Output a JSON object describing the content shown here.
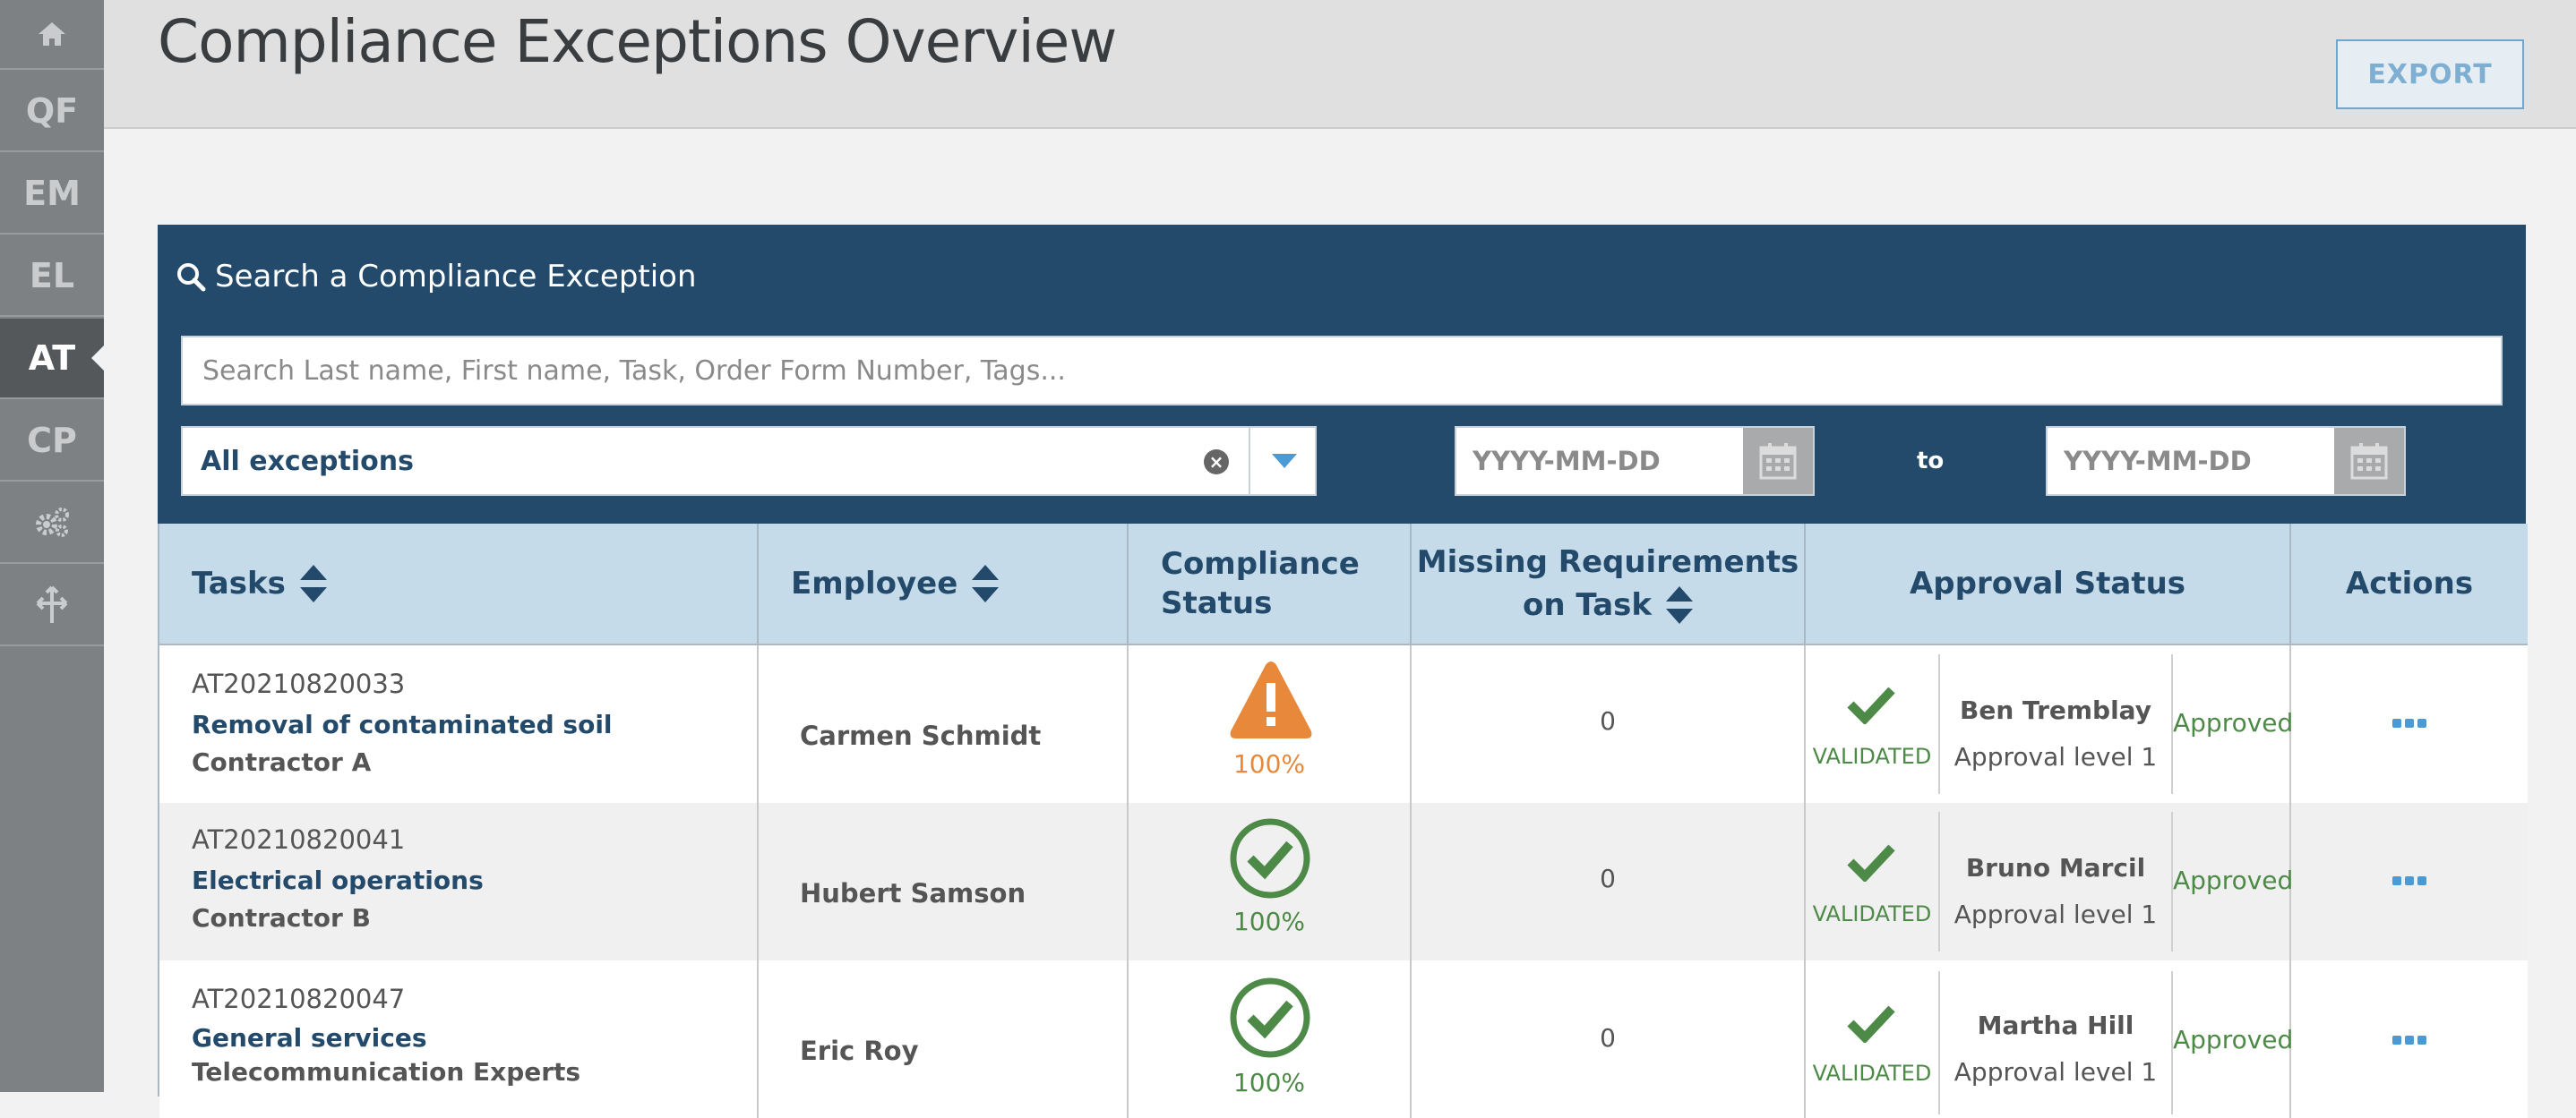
{
  "sidebar": {
    "items": [
      {
        "label": "",
        "icon": "home-icon"
      },
      {
        "label": "QF"
      },
      {
        "label": "EM"
      },
      {
        "label": "EL"
      },
      {
        "label": "AT",
        "active": true
      },
      {
        "label": "CP"
      },
      {
        "label": "",
        "icon": "gears-icon"
      },
      {
        "label": "",
        "icon": "arrows-icon"
      }
    ]
  },
  "header": {
    "title": "Compliance Exceptions Overview",
    "export_label": "EXPORT"
  },
  "search": {
    "title": "Search a Compliance Exception",
    "placeholder": "Search Last name, First name, Task, Order Form Number, Tags...",
    "filter_value": "All exceptions",
    "date_from_placeholder": "YYYY-MM-DD",
    "to_label": "to",
    "date_to_placeholder": "YYYY-MM-DD"
  },
  "table": {
    "headers": {
      "tasks": "Tasks",
      "employee": "Employee",
      "compliance_line1": "Compliance",
      "compliance_line2": "Status",
      "missing_line1": "Missing Requirements",
      "missing_line2": "on Task",
      "approval": "Approval Status",
      "actions": "Actions"
    },
    "rows": [
      {
        "task_id": "AT20210820033",
        "task_name": "Removal of contaminated soil",
        "contractor": "Contractor A",
        "employee": "Carmen Schmidt",
        "compliance_icon": "warning-icon",
        "compliance_pct": "100%",
        "missing": "0",
        "validated": "VALIDATED",
        "approver": "Ben Tremblay",
        "approval_level": "Approval level 1",
        "status": "Approved"
      },
      {
        "task_id": "AT20210820041",
        "task_name": "Electrical operations",
        "contractor": "Contractor B",
        "employee": "Hubert Samson",
        "compliance_icon": "check-circle-icon",
        "compliance_pct": "100%",
        "missing": "0",
        "validated": "VALIDATED",
        "approver": "Bruno Marcil",
        "approval_level": "Approval level 1",
        "status": "Approved"
      },
      {
        "task_id": "AT20210820047",
        "task_name": "General services",
        "contractor": "Telecommunication Experts",
        "employee": "Eric Roy",
        "compliance_icon": "check-circle-icon",
        "compliance_pct": "100%",
        "missing": "0",
        "validated": "VALIDATED",
        "approver": "Martha Hill",
        "approval_level": "Approval level 1",
        "status": "Approved"
      }
    ]
  },
  "colors": {
    "navy": "#234a6b",
    "header_blue": "#c5dbea",
    "warning_orange": "#e8883a",
    "success_green": "#4e8a47",
    "action_blue": "#4a9ad6"
  }
}
